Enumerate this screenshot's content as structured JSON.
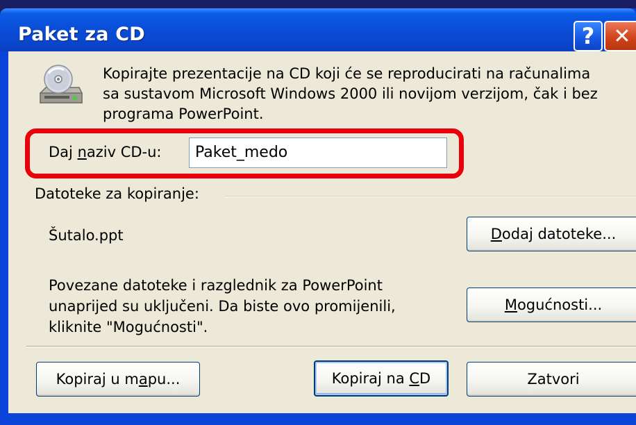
{
  "window": {
    "title": "Paket za CD",
    "help_glyph": "?",
    "close_glyph": "✕"
  },
  "intro": {
    "lines": [
      "Kopirajte prezentacije na CD koji će se reproducirati na računalima",
      "sa sustavom Microsoft Windows 2000 ili novijom verzijom, čak i bez",
      "programa PowerPoint."
    ]
  },
  "name_field": {
    "label_before": "Daj ",
    "label_access": "n",
    "label_after": "aziv CD-u:",
    "value": "Paket_medo",
    "highlight_color": "#e8000a"
  },
  "files": {
    "group_label": "Datoteke za kopiranje:",
    "file_name": "Šutalo.ppt",
    "add_button": {
      "access": "D",
      "rest": "odaj datoteke..."
    },
    "linked_note_lines": [
      "Povezane datoteke i razglednik za PowerPoint",
      "unaprijed su uključeni. Da biste ovo promijenili,",
      "kliknite \"Mogućnosti\"."
    ],
    "options_button": {
      "access": "M",
      "rest": "ogućnosti..."
    }
  },
  "footer": {
    "copy_folder": {
      "before": "Kopiraj u m",
      "access": "a",
      "after": "pu..."
    },
    "copy_cd": {
      "before": "Kopiraj na ",
      "access": "C",
      "after": "D"
    },
    "close_label": "Zatvori"
  },
  "colors": {
    "titlebar": "#0a4ed8",
    "client_bg": "#ece9d8",
    "close_button": "#d2441c"
  }
}
